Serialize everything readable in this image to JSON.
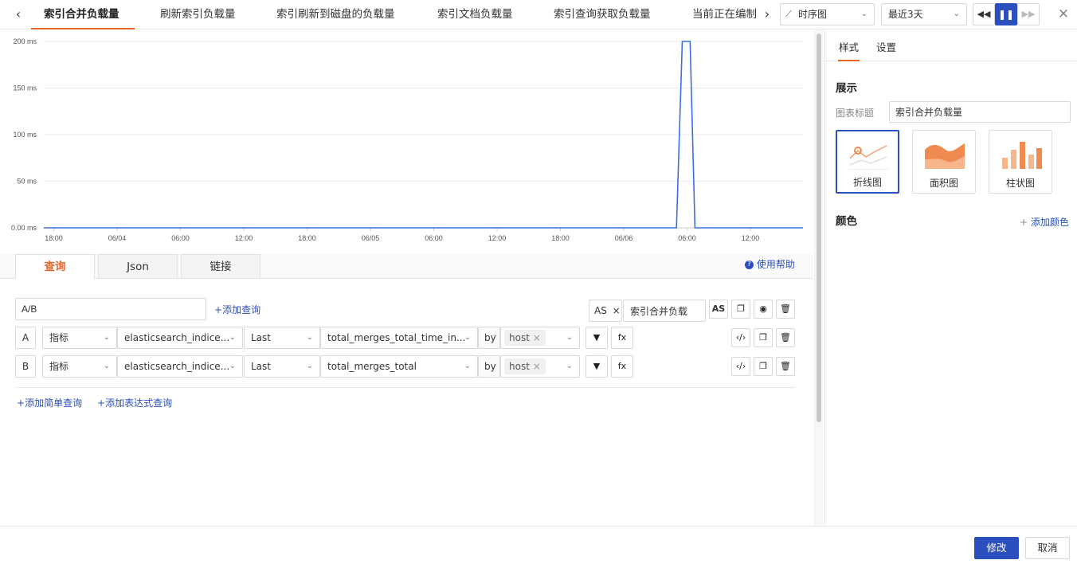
{
  "topbar": {
    "back_icon": "chevron-left-icon",
    "tabs": [
      {
        "label": "索引合并负载量",
        "active": true
      },
      {
        "label": "刷新索引负载量",
        "active": false
      },
      {
        "label": "索引刷新到磁盘的负载量",
        "active": false
      },
      {
        "label": "索引文档负载量",
        "active": false
      },
      {
        "label": "索引查询获取负载量",
        "active": false
      },
      {
        "label": "当前正在编制",
        "active": false
      }
    ],
    "chart_type_select": "时序图",
    "time_range_select": "最近3天",
    "accent_color": "#e8662b"
  },
  "chart_data": {
    "type": "line",
    "title": "",
    "xlabel": "",
    "ylabel": "",
    "ylim": [
      0,
      200
    ],
    "y_ticks": [
      "0.00 ms",
      "50 ms",
      "100 ms",
      "150 ms",
      "200 ms"
    ],
    "x_ticks": [
      "18:00",
      "06/04",
      "06:00",
      "12:00",
      "18:00",
      "06/05",
      "06:00",
      "12:00",
      "18:00",
      "06/06",
      "06:00",
      "12:00"
    ],
    "x_range": [
      0,
      156
    ],
    "series": [
      {
        "color": "#3b6fe0",
        "x": [
          0,
          130,
          131.2,
          132.8,
          133.8,
          156
        ],
        "y": [
          0,
          0,
          200,
          200,
          0,
          0
        ]
      }
    ],
    "grid": true
  },
  "query": {
    "tabs": [
      "查询",
      "Json",
      "链接"
    ],
    "help_label": "使用帮助",
    "expression_value": "A/B",
    "add_query_label": "添加查询",
    "as_label": "AS",
    "as_value": "索引合并负载",
    "as_button_label": "AS",
    "rows": [
      {
        "id": "A",
        "type": "指标",
        "metric": "elasticsearch_indice...",
        "agg": "Last",
        "field": "total_merges_total_time_in...",
        "by_label": "by",
        "group_tag": "host",
        "fx_label": "fx"
      },
      {
        "id": "B",
        "type": "指标",
        "metric": "elasticsearch_indice...",
        "agg": "Last",
        "field": "total_merges_total",
        "by_label": "by",
        "group_tag": "host",
        "fx_label": "fx"
      }
    ],
    "add_simple_label": "添加简单查询",
    "add_expr_label": "添加表达式查询"
  },
  "right_panel": {
    "tabs": [
      "样式",
      "设置"
    ],
    "section_display": "展示",
    "chart_title_label": "图表标题",
    "chart_title_value": "索引合并负载量",
    "chart_types": [
      {
        "label": "折线图",
        "active": true
      },
      {
        "label": "面积图",
        "active": false
      },
      {
        "label": "柱状图",
        "active": false
      }
    ],
    "section_color": "颜色",
    "add_color_label": "添加颜色"
  },
  "footer": {
    "submit_label": "修改",
    "cancel_label": "取消",
    "primary_color": "#2c4fbf"
  }
}
